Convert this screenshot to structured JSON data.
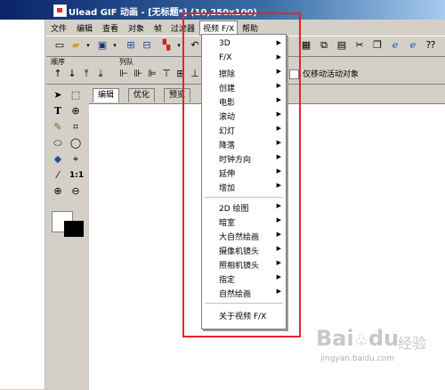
{
  "window": {
    "title": "Ulead GIF 动画 - [无标题*] (10,250x100)"
  },
  "menubar": {
    "items": [
      "文件",
      "编辑",
      "查看",
      "对象",
      "帧",
      "过滤器",
      "视频 F/X",
      "帮助"
    ]
  },
  "toolbar": {
    "icons": [
      "new-icon",
      "open-icon",
      "dropdown-arrow",
      "save-icon",
      "dropdown-arrow",
      "import-icon",
      "export-icon",
      "paint-icon",
      "dropdown-arrow",
      "undo-icon"
    ],
    "right_icons": [
      "frame-icon",
      "duplicate-icon",
      "delete-frame-icon",
      "cut-icon",
      "copy-icon",
      "ie-icon",
      "ie-preview-icon",
      "help-icon"
    ]
  },
  "labels": {
    "order": "顺序",
    "queue": "列队"
  },
  "checkbox": {
    "label": "仅移动活动对象",
    "checked": false
  },
  "tabs": [
    {
      "label": "编辑"
    },
    {
      "label": "优化"
    },
    {
      "label": "预览"
    }
  ],
  "dropdown": {
    "group1": [
      "3D",
      "F/X",
      "擦除",
      "创建",
      "电影",
      "滚动",
      "幻灯",
      "降落",
      "时钟方向",
      "延伸",
      "增加"
    ],
    "group2": [
      "2D 绘图",
      "暗室",
      "大自然绘画",
      "摄像机镜头",
      "照相机镜头",
      "指定",
      "自然绘画"
    ],
    "about": "关于视频 F/X"
  },
  "colors": {
    "highlight": "#e8222c",
    "foreground": "#000000",
    "background": "#ffffff"
  },
  "watermark": {
    "brand": "Bai",
    "brand_suffix": "du",
    "cn": "经验",
    "url": "jingyan.baidu.com"
  }
}
